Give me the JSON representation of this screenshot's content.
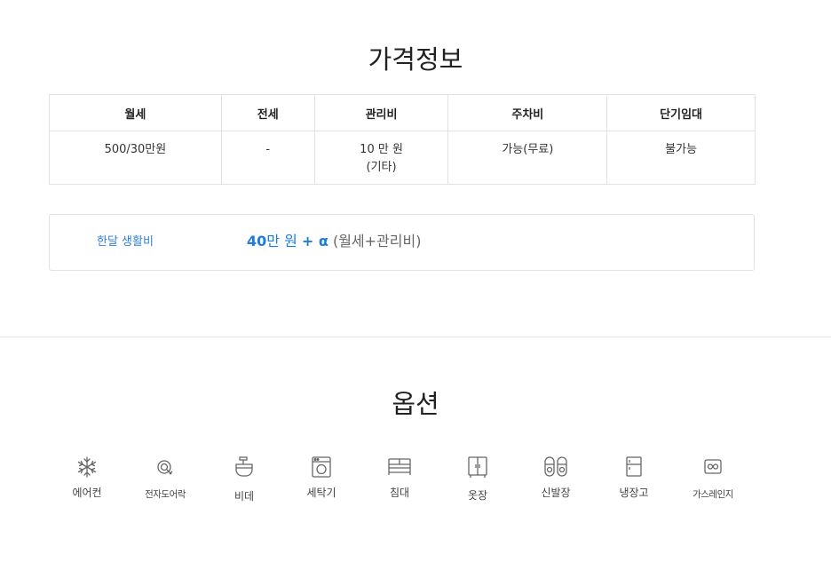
{
  "price_section": {
    "title": "가격정보",
    "table": {
      "headers": [
        "월세",
        "전세",
        "관리비",
        "주차비",
        "단기임대"
      ],
      "row": {
        "monthly_rent": "500/30만원",
        "jeonse": "-",
        "maintenance_fee": "10 만 원",
        "maintenance_note": "(기타)",
        "parking": "가능(무료)",
        "short_term": "불가능"
      }
    },
    "living_cost": {
      "label": "한달 생활비",
      "amount": "40",
      "unit": "만 원",
      "plus": "+ α",
      "note": "(월세+관리비)"
    }
  },
  "options_section": {
    "title": "옵션",
    "items": [
      {
        "label": "에어컨",
        "icon": "snowflake-icon"
      },
      {
        "label": "전자도어락",
        "icon": "door-lock-icon"
      },
      {
        "label": "비데",
        "icon": "bidet-icon"
      },
      {
        "label": "세탁기",
        "icon": "washing-machine-icon"
      },
      {
        "label": "침대",
        "icon": "bed-icon"
      },
      {
        "label": "옷장",
        "icon": "wardrobe-icon"
      },
      {
        "label": "신발장",
        "icon": "shoes-icon"
      },
      {
        "label": "냉장고",
        "icon": "refrigerator-icon"
      },
      {
        "label": "가스레인지",
        "icon": "gas-range-icon"
      }
    ]
  }
}
